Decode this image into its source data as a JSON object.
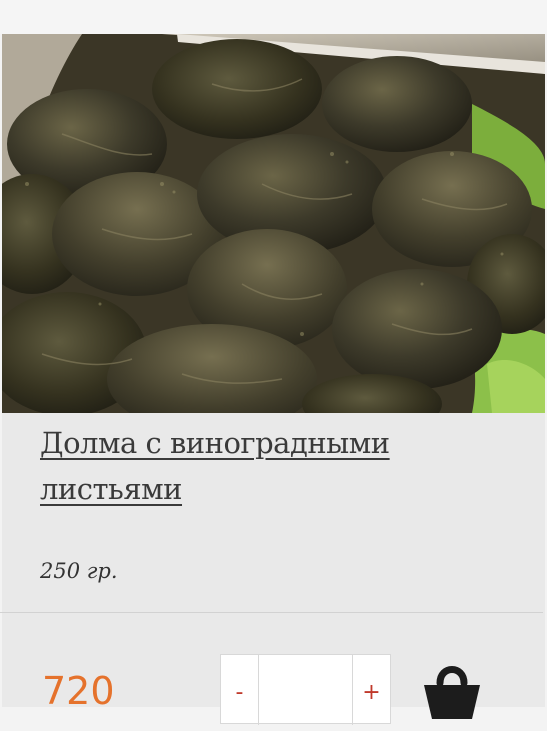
{
  "product": {
    "title": "Долма с виноградными листьями",
    "weight": "250 гр.",
    "price": "720",
    "image": "dolma-photo"
  },
  "quantity": {
    "minus_label": "-",
    "plus_label": "+",
    "value": ""
  },
  "icons": {
    "cart": "shopping-basket-icon"
  },
  "colors": {
    "price": "#e5722c",
    "stepper_sign": "#c0392b",
    "title": "#3a3a3a",
    "card_background": "#e9e9e9"
  }
}
